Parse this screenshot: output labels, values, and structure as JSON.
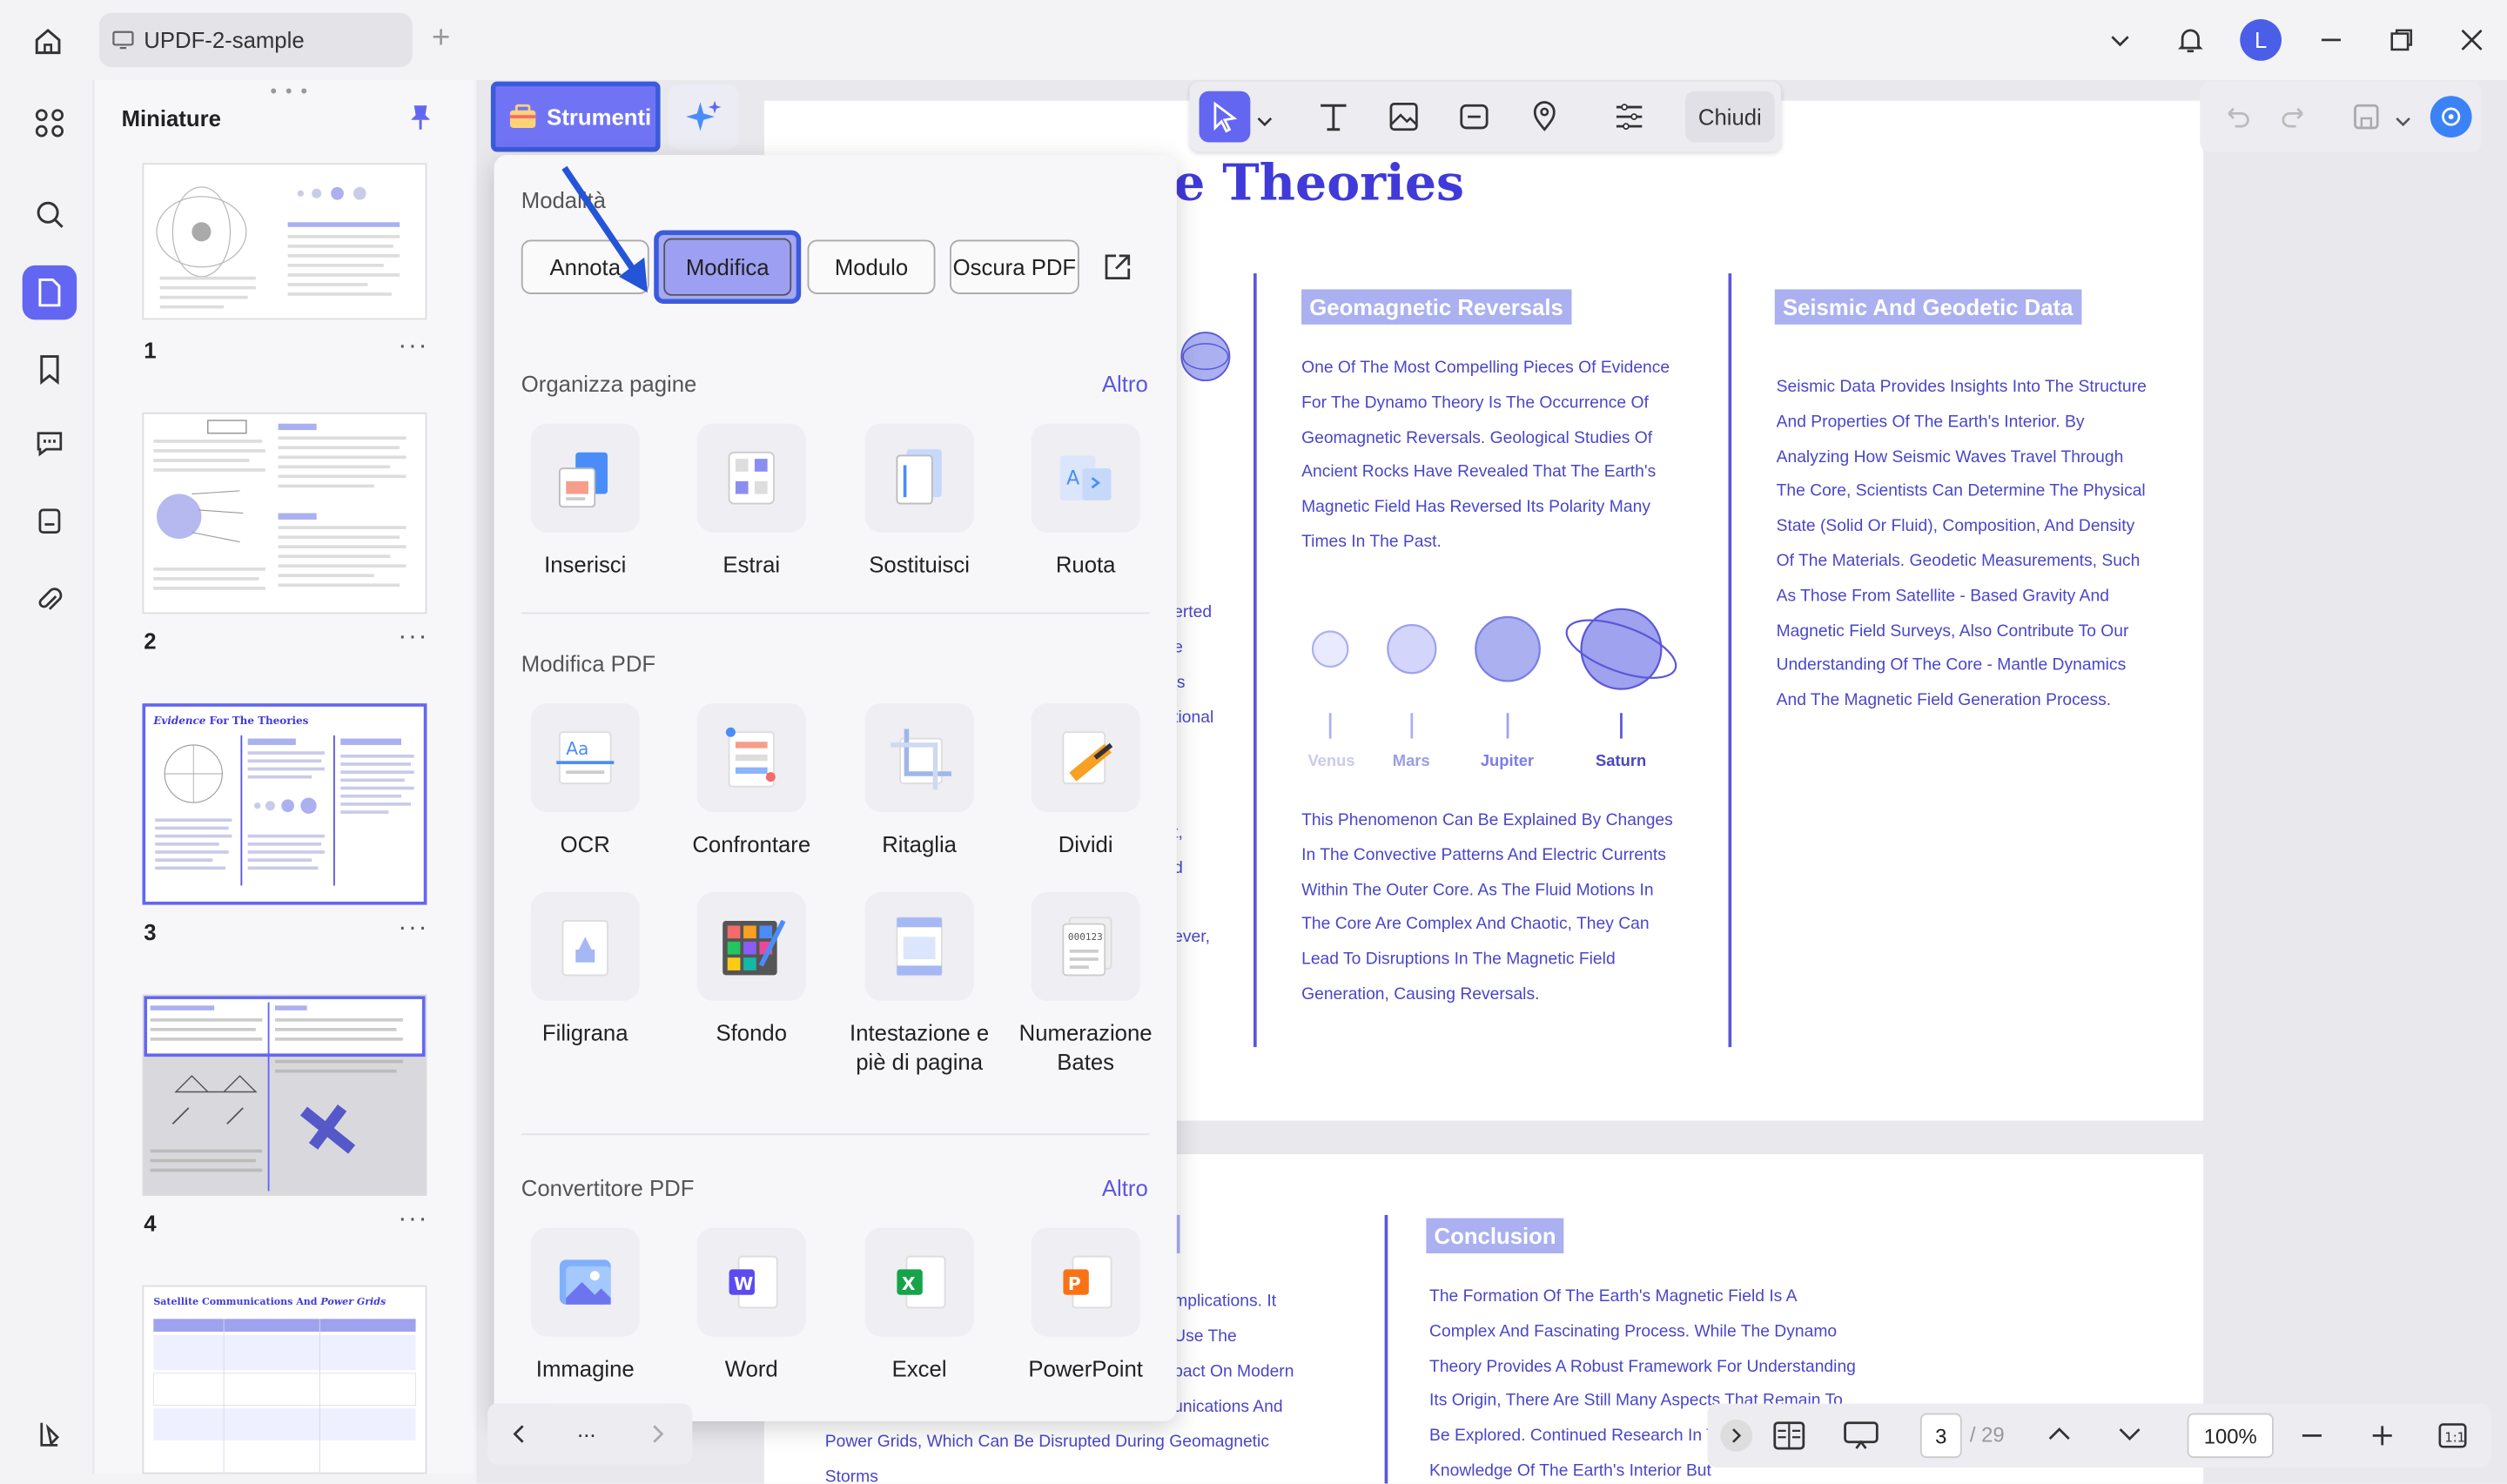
{
  "window": {
    "tab_title": "UPDF-2-sample",
    "avatar_letter": "L"
  },
  "sidebar": {
    "title": "Miniature",
    "pages": [
      "1",
      "2",
      "3",
      "4"
    ],
    "selected_page": "3",
    "thumb3_title_italic": "Evidence",
    "thumb3_title": "For The Theories",
    "thumb5_title": "Satellite Communications And",
    "thumb5_title_italic": "Power Grids"
  },
  "toolbar": {
    "strumenti_label": "Strumenti",
    "close_label": "Chiudi"
  },
  "panel": {
    "modes_heading": "Modalità",
    "modes": [
      "Annota",
      "Modifica",
      "Modulo",
      "Oscura PDF"
    ],
    "selected_mode": "Modifica",
    "organize_heading": "Organizza pagine",
    "organize_more": "Altro",
    "organize_tools": [
      "Inserisci",
      "Estrai",
      "Sostituisci",
      "Ruota"
    ],
    "edit_heading": "Modifica PDF",
    "edit_tools": [
      "OCR",
      "Confrontare",
      "Ritaglia",
      "Dividi",
      "Filigrana",
      "Sfondo",
      "Intestazione e piè di pagina",
      "Numerazione Bates"
    ],
    "convert_heading": "Convertitore PDF",
    "convert_more": "Altro",
    "convert_tools": [
      "Immagine",
      "Word",
      "Excel",
      "PowerPoint"
    ]
  },
  "document": {
    "title_visible": "e Theories",
    "geomagnetic_heading": "Geomagnetic Reversals",
    "geomagnetic_text": "One Of The Most Compelling Pieces Of Evidence For The Dynamo Theory Is The Occurrence Of Geomagnetic Reversals. Geological Studies Of Ancient Rocks Have Revealed That The Earth's Magnetic Field Has Reversed Its Polarity Many Times In The Past.",
    "planets": [
      "Venus",
      "Mars",
      "Jupiter",
      "Saturn"
    ],
    "phenomenon_text": "This Phenomenon Can Be Explained By Changes In The Convective Patterns And Electric Currents Within The Outer Core. As The Fluid Motions In The Core Are Complex And Chaotic, They Can Lead To Disruptions In The Magnetic Field Generation, Causing Reversals.",
    "seismic_heading": "Seismic And Geodetic Data",
    "seismic_text": "Seismic Data Provides Insights Into The Structure And Properties Of The Earth's Interior. By Analyzing How Seismic Waves Travel Through The Core, Scientists Can Determine The Physical State (Solid Or Fluid), Composition, And Density Of The Materials. Geodetic Measurements, Such As Those From Satellite - Based Gravity And Magnetic Field Surveys, Also Contribute To Our Understanding Of The Core - Mantle Dynamics And The Magnetic Field Generation Process.",
    "left_fragments": [
      "erted",
      "e",
      "'s",
      "tional",
      "t,",
      "d",
      "ever,"
    ],
    "conclusion_heading": "Conclusion",
    "conclusion_text": "The Formation Of The Earth's Magnetic Field Is A Complex And Fascinating Process. While The Dynamo Theory Provides A Robust Framework For Understanding Its Origin, There Are Still Many Aspects That Remain To Be Explored. Continued Research In T Only Deepen Our Knowledge Of The Earth's Interior But",
    "p2_fragments": [
      "mplications. It",
      "Use The",
      "pact On Modern",
      "unications And"
    ],
    "p2_line": "Power Grids, Which Can Be Disrupted During Geomagnetic",
    "p2_last": "Storms"
  },
  "bottom_bar": {
    "ellipsis": "...",
    "current_page": "3",
    "total_pages": "/ 29",
    "zoom": "100%"
  },
  "colors": {
    "accent": "#6366f1",
    "doc_text": "#4a46c8",
    "highlight_border": "#3b5bdb"
  }
}
